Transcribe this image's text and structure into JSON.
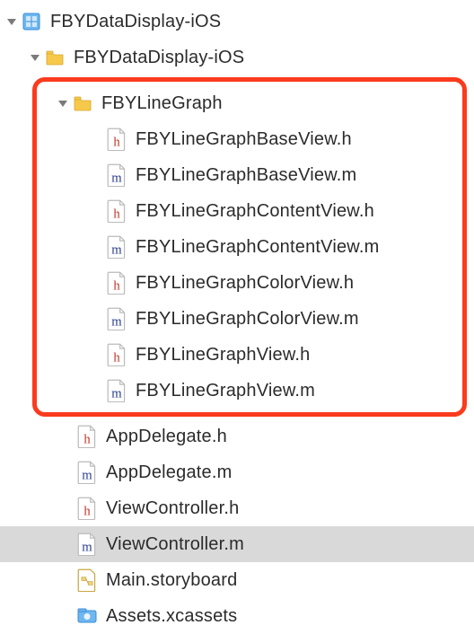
{
  "tree": {
    "root": {
      "label": "FBYDataDisplay-iOS",
      "icon": "xcode-project",
      "expanded": true
    },
    "group1": {
      "label": "FBYDataDisplay-iOS",
      "icon": "folder",
      "expanded": true
    },
    "group2": {
      "label": "FBYLineGraph",
      "icon": "folder",
      "expanded": true
    },
    "files_highlighted": [
      {
        "label": "FBYLineGraphBaseView.h",
        "type": "h"
      },
      {
        "label": "FBYLineGraphBaseView.m",
        "type": "m"
      },
      {
        "label": "FBYLineGraphContentView.h",
        "type": "h"
      },
      {
        "label": "FBYLineGraphContentView.m",
        "type": "m"
      },
      {
        "label": "FBYLineGraphColorView.h",
        "type": "h"
      },
      {
        "label": "FBYLineGraphColorView.m",
        "type": "m"
      },
      {
        "label": "FBYLineGraphView.h",
        "type": "h"
      },
      {
        "label": "FBYLineGraphView.m",
        "type": "m"
      }
    ],
    "files_rest": [
      {
        "label": "AppDelegate.h",
        "type": "h",
        "selected": false
      },
      {
        "label": "AppDelegate.m",
        "type": "m",
        "selected": false
      },
      {
        "label": "ViewController.h",
        "type": "h",
        "selected": false
      },
      {
        "label": "ViewController.m",
        "type": "m",
        "selected": true
      },
      {
        "label": "Main.storyboard",
        "type": "storyboard",
        "selected": false
      },
      {
        "label": "Assets.xcassets",
        "type": "xcassets",
        "selected": false
      }
    ]
  },
  "icons": {
    "h_color": "#c0392b",
    "m_color": "#2c3e8f"
  }
}
